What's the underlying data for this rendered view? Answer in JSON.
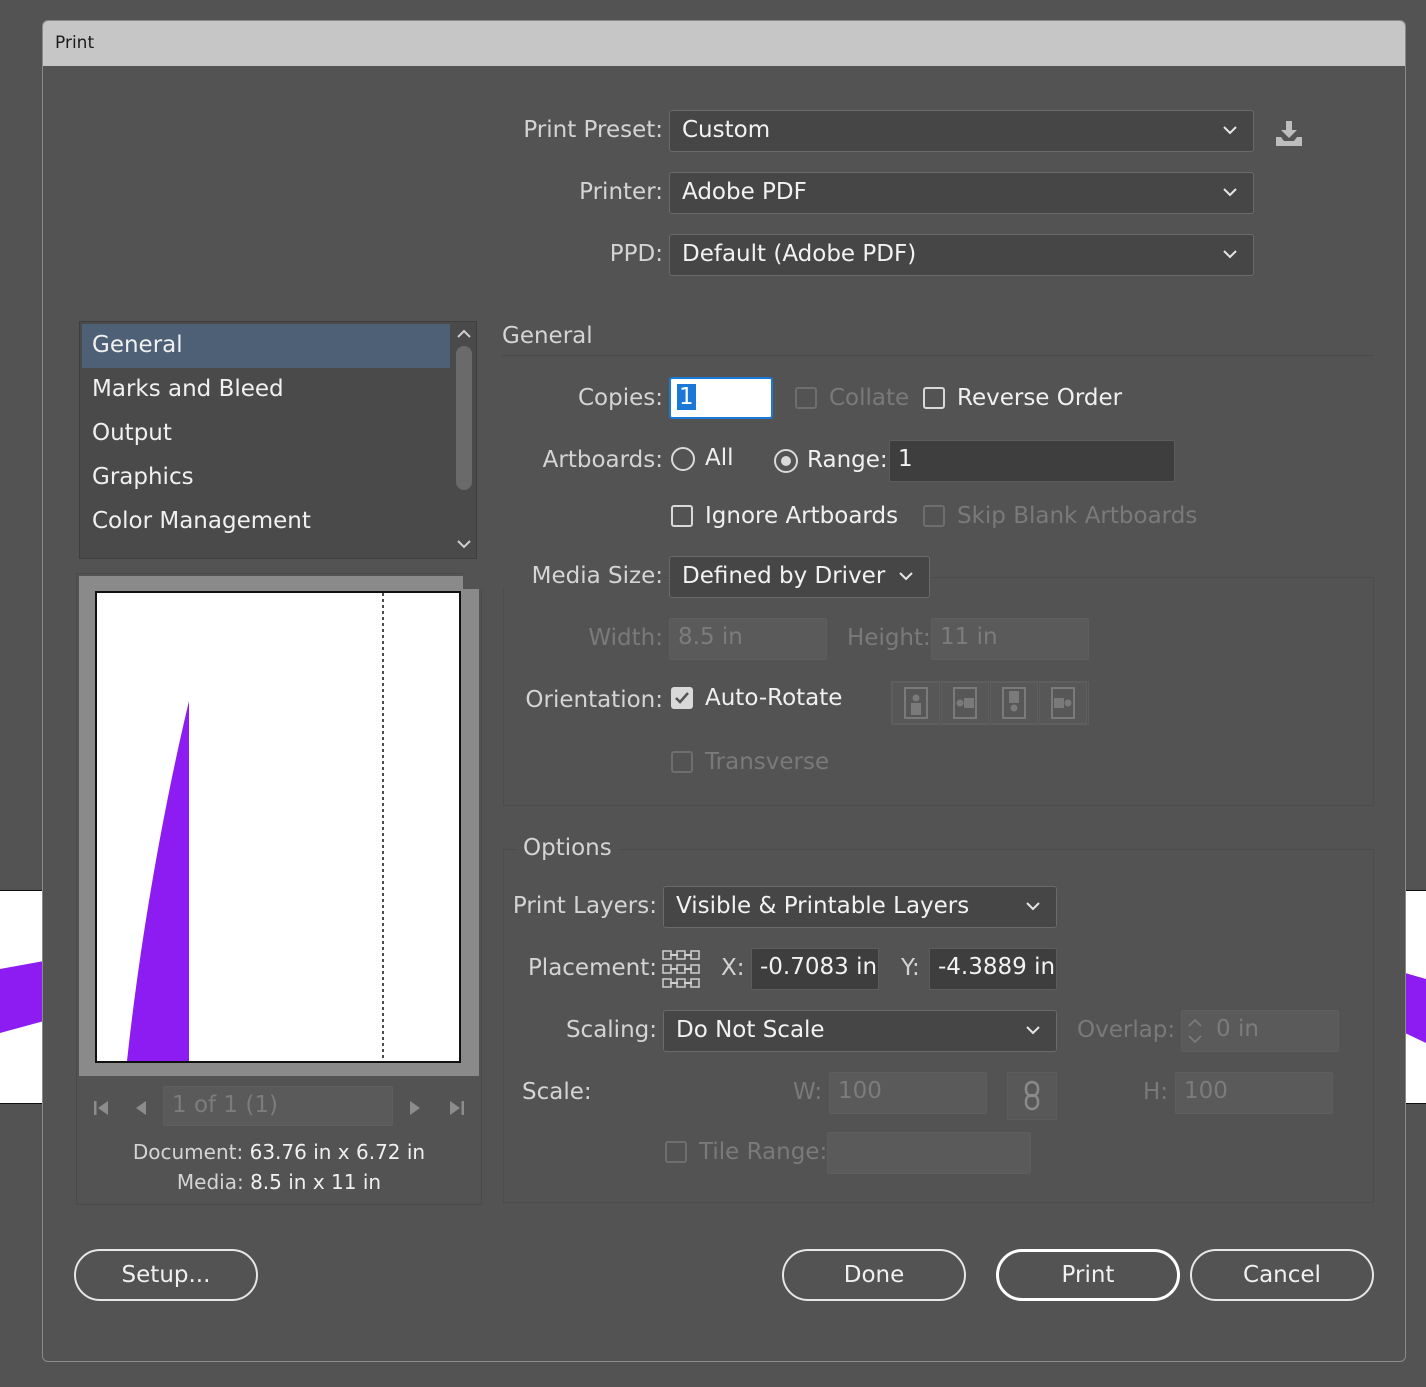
{
  "window": {
    "title": "Print"
  },
  "top": {
    "print_preset_label": "Print Preset:",
    "print_preset_value": "Custom",
    "printer_label": "Printer:",
    "printer_value": "Adobe PDF",
    "ppd_label": "PPD:",
    "ppd_value": "Default (Adobe PDF)"
  },
  "sidebar": {
    "items": [
      {
        "label": "General",
        "selected": true
      },
      {
        "label": "Marks and Bleed"
      },
      {
        "label": "Output"
      },
      {
        "label": "Graphics"
      },
      {
        "label": "Color Management"
      }
    ]
  },
  "preview": {
    "page_indicator": "1 of 1 (1)",
    "document_label": "Document:",
    "document_value": "63.76 in x 6.72 in",
    "media_label": "Media:",
    "media_value": "8.5 in x 11 in",
    "shape_color": "#8c1cf2"
  },
  "general": {
    "section_title": "General",
    "copies_label": "Copies:",
    "copies_value": "1",
    "collate_label": "Collate",
    "reverse_order_label": "Reverse Order",
    "artboards_label": "Artboards:",
    "all_label": "All",
    "range_label": "Range:",
    "range_value": "1",
    "ignore_artboards_label": "Ignore Artboards",
    "skip_blank_label": "Skip Blank Artboards",
    "media_size_label": "Media Size:",
    "media_size_value": "Defined by Driver",
    "width_label": "Width:",
    "width_value": "8.5 in",
    "height_label": "Height:",
    "height_value": "11 in",
    "orientation_label": "Orientation:",
    "auto_rotate_label": "Auto-Rotate",
    "transverse_label": "Transverse"
  },
  "options": {
    "section_title": "Options",
    "print_layers_label": "Print Layers:",
    "print_layers_value": "Visible & Printable Layers",
    "placement_label": "Placement:",
    "x_label": "X:",
    "x_value": "-0.7083 in",
    "y_label": "Y:",
    "y_value": "-4.3889 in",
    "scaling_label": "Scaling:",
    "scaling_value": "Do Not Scale",
    "overlap_label": "Overlap:",
    "overlap_value": "0 in",
    "scale_label": "Scale:",
    "w_label": "W:",
    "w_value": "100",
    "h_label": "H:",
    "h_value": "100",
    "tile_range_label": "Tile Range:"
  },
  "buttons": {
    "setup": "Setup...",
    "done": "Done",
    "print": "Print",
    "cancel": "Cancel"
  },
  "colors": {
    "background": "#535353",
    "titlebar": "#c6c6c6",
    "selection": "#4d6076",
    "focus": "#1a78d6"
  }
}
